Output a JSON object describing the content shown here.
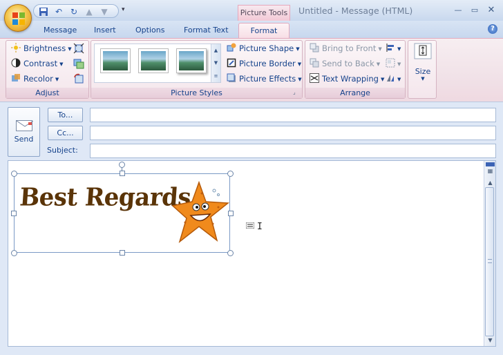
{
  "window": {
    "title": "Untitled - Message (HTML)",
    "contextual_tab_group": "Picture Tools"
  },
  "tabs": [
    {
      "label": "Message"
    },
    {
      "label": "Insert"
    },
    {
      "label": "Options"
    },
    {
      "label": "Format Text"
    },
    {
      "label": "Format",
      "active": true
    }
  ],
  "ribbon": {
    "adjust": {
      "label": "Adjust",
      "brightness": "Brightness",
      "contrast": "Contrast",
      "recolor": "Recolor"
    },
    "picture_styles": {
      "label": "Picture Styles",
      "shape": "Picture Shape",
      "border": "Picture Border",
      "effects": "Picture Effects"
    },
    "arrange": {
      "label": "Arrange",
      "bring_to_front": "Bring to Front",
      "send_to_back": "Send to Back",
      "text_wrapping": "Text Wrapping"
    },
    "size": {
      "label": "Size"
    }
  },
  "compose": {
    "send_label": "Send",
    "to_label": "To...",
    "cc_label": "Cc...",
    "subject_label": "Subject:",
    "to_value": "",
    "cc_value": "",
    "subject_value": ""
  },
  "body": {
    "signature_text": "Best Regards,"
  },
  "colors": {
    "accent_contextual": "#f3c9d6",
    "ribbon_text": "#15428b",
    "signature_text": "#5a3408",
    "starfish": "#f08a1c"
  }
}
